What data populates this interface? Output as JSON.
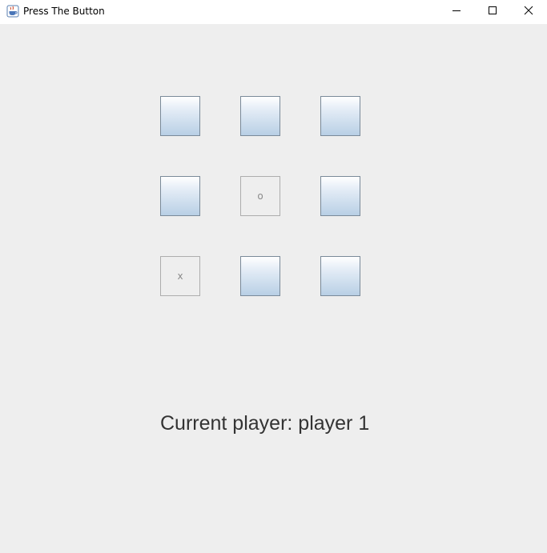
{
  "window": {
    "title": "Press The Button"
  },
  "board": {
    "cells": [
      {
        "row": 1,
        "col": 1,
        "mark": ""
      },
      {
        "row": 1,
        "col": 2,
        "mark": ""
      },
      {
        "row": 1,
        "col": 3,
        "mark": ""
      },
      {
        "row": 2,
        "col": 1,
        "mark": ""
      },
      {
        "row": 2,
        "col": 2,
        "mark": "o"
      },
      {
        "row": 2,
        "col": 3,
        "mark": ""
      },
      {
        "row": 3,
        "col": 1,
        "mark": "x"
      },
      {
        "row": 3,
        "col": 2,
        "mark": ""
      },
      {
        "row": 3,
        "col": 3,
        "mark": ""
      }
    ]
  },
  "status": {
    "text": "Current player: player 1"
  },
  "icons": {
    "app": "java-cup-icon",
    "minimize": "minimize-icon",
    "maximize": "maximize-icon",
    "close": "close-icon"
  }
}
